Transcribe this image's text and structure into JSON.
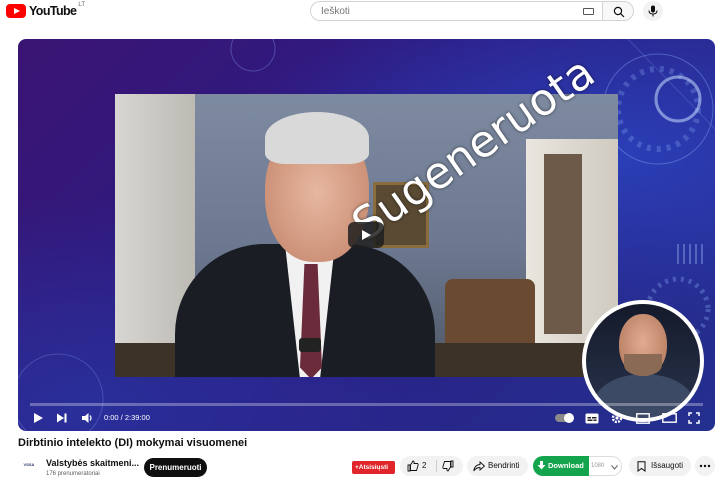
{
  "header": {
    "logo_text": "YouTube",
    "country_code": "LT",
    "search_placeholder": "Ieškoti",
    "icons": [
      "youtube-logo-icon",
      "keyboard-icon",
      "search-icon",
      "microphone-icon"
    ]
  },
  "player": {
    "watermark": "Sugeneruota",
    "time_display": "0:00 / 2:39:00",
    "progress": 0,
    "icons": [
      "play-icon",
      "next-icon",
      "volume-icon",
      "autoplay-toggle",
      "subtitles-icon",
      "settings-icon",
      "miniplayer-icon",
      "theater-icon",
      "fullscreen-icon"
    ]
  },
  "video": {
    "title": "Dirbtinio intelekto (DI) mokymai visuomenei"
  },
  "channel": {
    "logo_text": "VSSA",
    "name": "Valstybės skaitmeni...",
    "subscribers": "176 prenumeratoriai",
    "subscribe_label": "Prenumeruoti"
  },
  "actions": {
    "unsubscribe_label": "+Atsisiųsti",
    "like_count": "2",
    "share_label": "Bendrinti",
    "download_label": "Download",
    "quality_label": "1080",
    "save_label": "Išsaugoti"
  },
  "colors": {
    "brand_red": "#ff0000",
    "download_green": "#14a44d",
    "player_bg": "#2c1c84"
  }
}
